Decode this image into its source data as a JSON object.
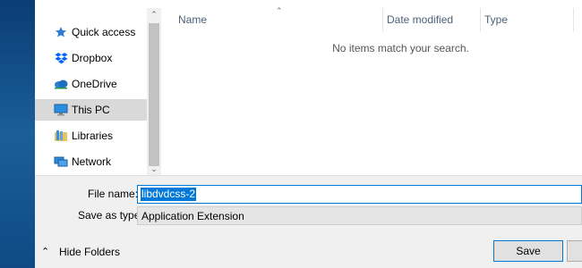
{
  "nav": {
    "items": [
      {
        "label": "Quick access",
        "icon": "star-icon"
      },
      {
        "label": "Dropbox",
        "icon": "dropbox-icon"
      },
      {
        "label": "OneDrive",
        "icon": "onedrive-icon"
      },
      {
        "label": "This PC",
        "icon": "computer-icon",
        "selected": true
      },
      {
        "label": "Libraries",
        "icon": "libraries-icon"
      },
      {
        "label": "Network",
        "icon": "network-icon"
      }
    ]
  },
  "file_list": {
    "columns": [
      "Name",
      "Date modified",
      "Type"
    ],
    "empty_message": "No items match your search."
  },
  "form": {
    "file_name_label": "File name:",
    "file_name_value": "libdvdcss-2",
    "save_as_type_label": "Save as type:",
    "save_as_type_value": "Application Extension"
  },
  "footer": {
    "hide_folders_label": "Hide Folders",
    "save_button_label": "Save"
  },
  "colors": {
    "accent": "#0078d7",
    "selected_nav": "#d9d9d9",
    "header_text": "#4c607a"
  }
}
